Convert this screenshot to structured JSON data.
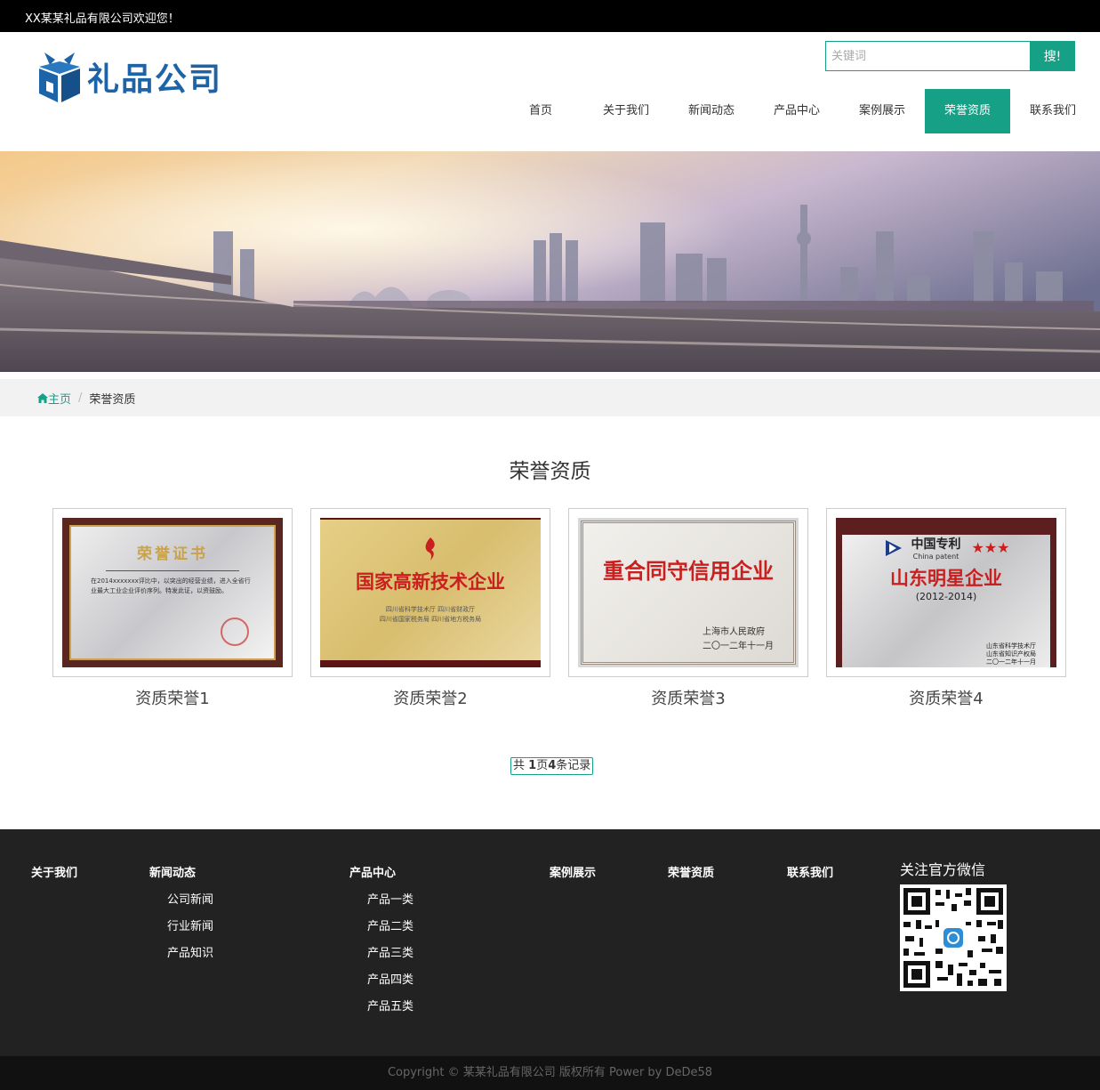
{
  "topbar": {
    "welcome": "XX某某礼品有限公司欢迎您！"
  },
  "header": {
    "logo_text": "礼品公司",
    "search": {
      "placeholder": "关键词",
      "button": "搜!"
    },
    "nav": [
      {
        "label": "首页"
      },
      {
        "label": "关于我们"
      },
      {
        "label": "新闻动态"
      },
      {
        "label": "产品中心"
      },
      {
        "label": "案例展示"
      },
      {
        "label": "荣誉资质",
        "active": true
      },
      {
        "label": "联系我们"
      }
    ]
  },
  "breadcrumb": {
    "home": "主页",
    "separator": "/",
    "current": "荣誉资质"
  },
  "main": {
    "title": "荣誉资质",
    "cards": [
      {
        "caption": "资质荣誉1",
        "cert_title": "荣誉证书",
        "cert_body": "在2014xxxxxxx评比中，以突出的经营业绩，进入全省行业最大工业企业评价序列。特发此证，以资鼓励。"
      },
      {
        "caption": "资质荣誉2",
        "cert_title": "国家高新技术企业",
        "cert_issuers": "四川省科学技术厅  四川省财政厅\n四川省国家税务局  四川省地方税务局"
      },
      {
        "caption": "资质荣誉3",
        "cert_title": "重合同守信用企业",
        "cert_issuer": "上海市人民政府",
        "cert_date": "二〇一二年十一月"
      },
      {
        "caption": "资质荣誉4",
        "cert_header": "中国专利",
        "cert_header_en": "China patent",
        "cert_title": "山东明星企业",
        "cert_years": "(2012-2014)",
        "cert_issuer1": "山东省科学技术厅",
        "cert_issuer2": "山东省知识产权局",
        "cert_date": "二〇一二年十一月"
      }
    ],
    "pager": {
      "prefix": "共 ",
      "pages": "1",
      "middle": "页",
      "records": "4",
      "suffix": "条记录"
    }
  },
  "footer": {
    "columns": [
      {
        "title": "关于我们",
        "links": []
      },
      {
        "title": "新闻动态",
        "links": [
          "公司新闻",
          "行业新闻",
          "产品知识"
        ]
      },
      {
        "title": "产品中心",
        "links": [
          "产品一类",
          "产品二类",
          "产品三类",
          "产品四类",
          "产品五类"
        ]
      },
      {
        "title": "案例展示",
        "links": []
      },
      {
        "title": "荣誉资质",
        "links": []
      },
      {
        "title": "联系我们",
        "links": []
      }
    ],
    "wechat_title": "关注官方微信",
    "copyright": "Copyright © 某某礼品有限公司 版权所有 Power by DeDe58"
  },
  "colors": {
    "accent": "#16a085",
    "topbar": "#000000",
    "footer": "#222222",
    "logo": "#1d63a8"
  }
}
